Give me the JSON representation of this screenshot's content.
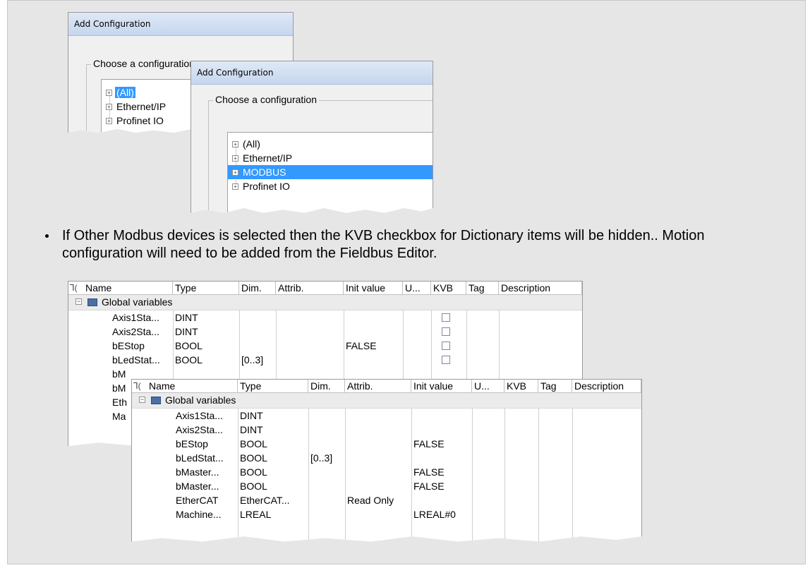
{
  "dialog1": {
    "title": "Add Configuration",
    "group_label": "Choose a configuration",
    "items": [
      "(All)",
      "Ethernet/IP",
      "Profinet IO"
    ],
    "selected_index": 0
  },
  "dialog2": {
    "title": "Add Configuration",
    "group_label": "Choose a configuration",
    "items": [
      "(All)",
      "Ethernet/IP",
      "MODBUS",
      "Profinet IO"
    ],
    "selected_index": 2
  },
  "bullet": {
    "text": "If Other Modbus devices is selected then the KVB checkbox for Dictionary items will be hidden.. Motion configuration will need to be added from the Fieldbus Editor."
  },
  "grid1": {
    "columns": [
      "Name",
      "Type",
      "Dim.",
      "Attrib.",
      "Init value",
      "U...",
      "KVB",
      "Tag",
      "Description"
    ],
    "group_label": "Global variables",
    "rows": [
      {
        "name": "Axis1Sta...",
        "type": "DINT",
        "dim": "",
        "attrib": "",
        "init": "",
        "kvb": true
      },
      {
        "name": "Axis2Sta...",
        "type": "DINT",
        "dim": "",
        "attrib": "",
        "init": "",
        "kvb": true
      },
      {
        "name": "bEStop",
        "type": "BOOL",
        "dim": "",
        "attrib": "",
        "init": "FALSE",
        "kvb": true
      },
      {
        "name": "bLedStat...",
        "type": "BOOL",
        "dim": "[0..3]",
        "attrib": "",
        "init": "",
        "kvb": true
      }
    ],
    "fragments": [
      "bM",
      "bM",
      "Eth",
      "Ma"
    ]
  },
  "grid2": {
    "columns": [
      "Name",
      "Type",
      "Dim.",
      "Attrib.",
      "Init value",
      "U...",
      "KVB",
      "Tag",
      "Description"
    ],
    "group_label": "Global variables",
    "rows": [
      {
        "name": "Axis1Sta...",
        "type": "DINT",
        "dim": "",
        "attrib": "",
        "init": ""
      },
      {
        "name": "Axis2Sta...",
        "type": "DINT",
        "dim": "",
        "attrib": "",
        "init": ""
      },
      {
        "name": "bEStop",
        "type": "BOOL",
        "dim": "",
        "attrib": "",
        "init": "FALSE"
      },
      {
        "name": "bLedStat...",
        "type": "BOOL",
        "dim": "[0..3]",
        "attrib": "",
        "init": ""
      },
      {
        "name": "bMaster...",
        "type": "BOOL",
        "dim": "",
        "attrib": "",
        "init": "FALSE"
      },
      {
        "name": "bMaster...",
        "type": "BOOL",
        "dim": "",
        "attrib": "",
        "init": "FALSE"
      },
      {
        "name": "EtherCAT",
        "type": "EtherCAT...",
        "dim": "",
        "attrib": "Read Only",
        "init": ""
      },
      {
        "name": "Machine...",
        "type": "LREAL",
        "dim": "",
        "attrib": "",
        "init": "LREAL#0"
      }
    ]
  }
}
